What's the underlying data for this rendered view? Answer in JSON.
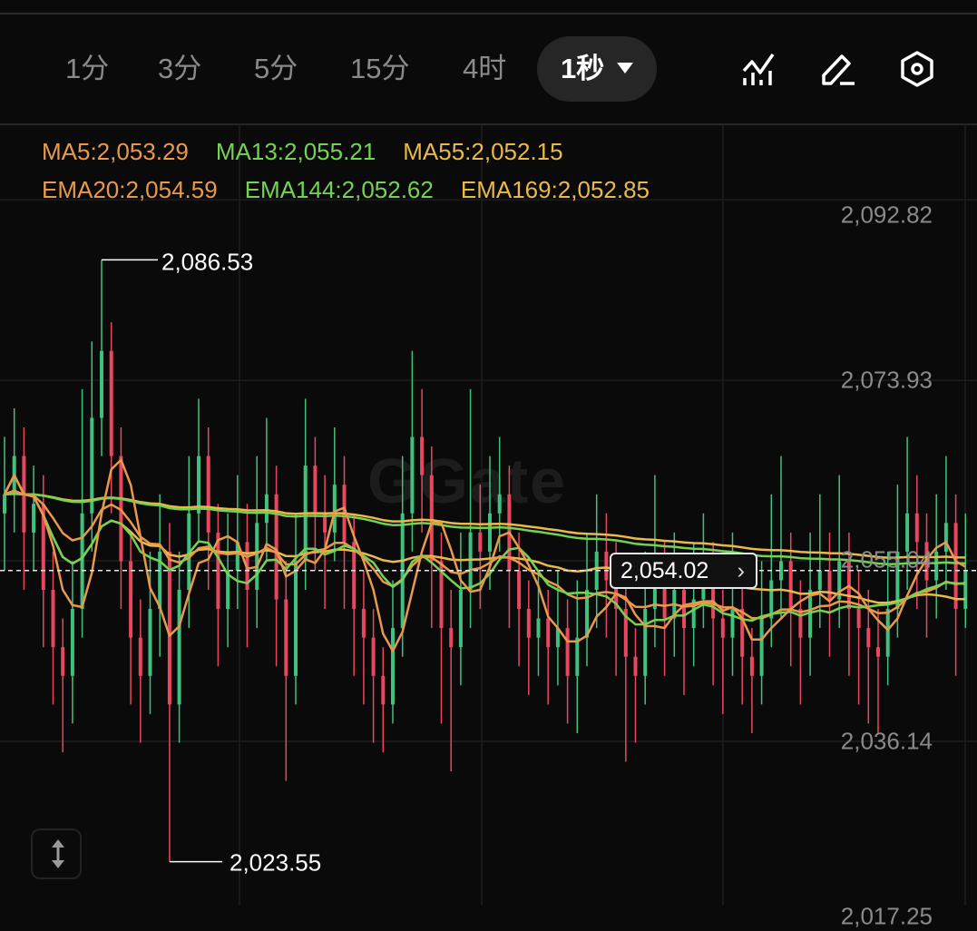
{
  "toolbar": {
    "tabs": [
      "1分",
      "3分",
      "5分",
      "15分",
      "4时"
    ],
    "active_tab": "1秒",
    "icons": [
      "indicator-chart-icon",
      "draw-pen-icon",
      "settings-hexagon-icon"
    ]
  },
  "watermark": "Gate",
  "legend": {
    "row1": [
      {
        "text": "MA5:2,053.29",
        "color": "#e9994b"
      },
      {
        "text": "MA13:2,055.21",
        "color": "#74d452"
      },
      {
        "text": "MA55:2,052.15",
        "color": "#e9b949"
      }
    ],
    "row2": [
      {
        "text": "EMA20:2,054.59",
        "color": "#e9994b"
      },
      {
        "text": "EMA144:2,052.62",
        "color": "#74d452"
      },
      {
        "text": "EMA169:2,052.85",
        "color": "#e9b949"
      }
    ]
  },
  "chart_data": {
    "type": "candlestick",
    "y_ticks": [
      2092.82,
      2073.93,
      2055.04,
      2036.14,
      2017.25
    ],
    "y_tick_labels": [
      "2,092.82",
      "2,073.93",
      "2,055.04",
      "2,036.14",
      "2,017.25"
    ],
    "high_label": "2,086.53",
    "low_label": "2,023.55",
    "current_price": 2054.02,
    "current_price_label": "2,054.02",
    "colors": {
      "up": "#3fc27d",
      "down": "#e8475f",
      "ma5": "#e9994b",
      "ma13": "#74d452",
      "ma55": "#e9b949",
      "ema20": "#e9994b",
      "ema144": "#74d452",
      "ema169": "#e9b949"
    },
    "open": [
      2060,
      2062,
      2066,
      2058,
      2061,
      2052,
      2046,
      2043,
      2050,
      2060,
      2070,
      2077,
      2066,
      2055,
      2047,
      2043,
      2050,
      2056,
      2040,
      2052,
      2060,
      2066,
      2058,
      2050,
      2054,
      2057,
      2052,
      2059,
      2062,
      2051,
      2043,
      2055,
      2065,
      2060,
      2058,
      2063,
      2057,
      2050,
      2047,
      2043,
      2040,
      2048,
      2060,
      2068,
      2064,
      2055,
      2048,
      2046,
      2052,
      2058,
      2056,
      2060,
      2062,
      2054,
      2050,
      2047,
      2049,
      2046,
      2048,
      2043,
      2047,
      2052,
      2056,
      2053,
      2050,
      2045,
      2043,
      2050,
      2053,
      2049,
      2052,
      2048,
      2051,
      2054,
      2049,
      2047,
      2050,
      2045,
      2043,
      2049,
      2053,
      2055,
      2050,
      2047,
      2052,
      2054,
      2051,
      2055,
      2050,
      2048,
      2046,
      2045,
      2050,
      2056,
      2060,
      2057,
      2053,
      2056,
      2059,
      2050
    ],
    "high": [
      2068,
      2071,
      2069,
      2065,
      2064,
      2056,
      2049,
      2055,
      2073,
      2078,
      2086.53,
      2080,
      2069,
      2058,
      2051,
      2056,
      2062,
      2059,
      2056,
      2066,
      2072,
      2069,
      2061,
      2060,
      2064,
      2061,
      2066,
      2070,
      2065,
      2055,
      2060,
      2072,
      2068,
      2064,
      2069,
      2066,
      2060,
      2054,
      2050,
      2046,
      2053,
      2066,
      2077,
      2073,
      2067,
      2058,
      2052,
      2058,
      2073,
      2063,
      2066,
      2068,
      2065,
      2058,
      2053,
      2054,
      2052,
      2054,
      2051,
      2053,
      2058,
      2062,
      2060,
      2057,
      2054,
      2048,
      2056,
      2064,
      2057,
      2058,
      2055,
      2057,
      2060,
      2057,
      2052,
      2058,
      2053,
      2048,
      2055,
      2062,
      2066,
      2058,
      2053,
      2058,
      2062,
      2058,
      2064,
      2058,
      2054,
      2052,
      2050,
      2056,
      2063,
      2068,
      2064,
      2060,
      2062,
      2066,
      2062,
      2060
    ],
    "low": [
      2054,
      2058,
      2052,
      2054,
      2046,
      2040,
      2035,
      2038,
      2047,
      2056,
      2066,
      2060,
      2050,
      2040,
      2036,
      2039,
      2045,
      2023.55,
      2036,
      2048,
      2057,
      2052,
      2044,
      2046,
      2050,
      2046,
      2048,
      2055,
      2044,
      2032,
      2040,
      2052,
      2054,
      2050,
      2055,
      2050,
      2043,
      2040,
      2036,
      2035,
      2038,
      2045,
      2056,
      2058,
      2048,
      2038,
      2033,
      2042,
      2048,
      2050,
      2052,
      2056,
      2048,
      2044,
      2041,
      2043,
      2040,
      2042,
      2038,
      2037,
      2044,
      2048,
      2047,
      2043,
      2034,
      2036,
      2040,
      2046,
      2043,
      2045,
      2041,
      2044,
      2048,
      2042,
      2039,
      2043,
      2040,
      2037,
      2040,
      2046,
      2049,
      2044,
      2040,
      2043,
      2048,
      2045,
      2048,
      2043,
      2040,
      2038,
      2037,
      2042,
      2047,
      2052,
      2050,
      2047,
      2049,
      2052,
      2043,
      2048
    ],
    "close": [
      2062,
      2066,
      2058,
      2061,
      2052,
      2046,
      2043,
      2050,
      2060,
      2070,
      2077,
      2066,
      2055,
      2047,
      2043,
      2050,
      2056,
      2040,
      2052,
      2060,
      2066,
      2058,
      2050,
      2054,
      2057,
      2052,
      2059,
      2062,
      2051,
      2043,
      2055,
      2065,
      2060,
      2058,
      2063,
      2057,
      2050,
      2047,
      2043,
      2040,
      2048,
      2060,
      2068,
      2064,
      2055,
      2048,
      2046,
      2052,
      2058,
      2056,
      2060,
      2062,
      2054,
      2050,
      2047,
      2049,
      2046,
      2048,
      2043,
      2047,
      2052,
      2056,
      2053,
      2050,
      2045,
      2043,
      2050,
      2053,
      2049,
      2052,
      2048,
      2051,
      2054,
      2049,
      2047,
      2050,
      2045,
      2043,
      2049,
      2053,
      2055,
      2050,
      2047,
      2052,
      2054,
      2051,
      2055,
      2050,
      2048,
      2046,
      2045,
      2050,
      2056,
      2060,
      2057,
      2053,
      2056,
      2059,
      2050,
      2054
    ],
    "overlays": [
      "MA5",
      "MA13",
      "MA55",
      "EMA20",
      "EMA144",
      "EMA169"
    ],
    "grid": true
  }
}
